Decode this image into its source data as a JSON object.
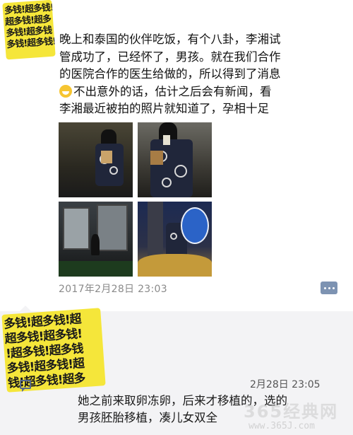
{
  "post": {
    "avatar_lines": [
      "多钱!超多钱!超",
      "超多钱!超多",
      "多钱!超多钱"
    ],
    "text_lines": [
      "晚上和泰国的伙伴吃饭，有个八卦，李湘试",
      "管成功了，已经怀了，男孩。就在我们合作",
      "的医院合作的医生给做的，所以得到了消息",
      "不出意外的话，估计之后会有新闻，看",
      "李湘最近被拍的照片就知道了，孕相十足"
    ],
    "emoji_icon": "grin-emoji-icon",
    "photos": [
      "photo-1",
      "photo-2",
      "photo-3",
      "photo-4"
    ],
    "timestamp": "2017年2月28日 23:03",
    "more_icon": "more-dots-icon"
  },
  "comment": {
    "avatar_lines": [
      "多钱!超多钱!超",
      "超多钱!超多钱!",
      "!超多钱!超多钱",
      "多钱!超多钱!超",
      "钱!超多钱!超多"
    ],
    "timestamp": "2月28日 23:05",
    "text_lines": [
      "她之前来取卵冻卵，后来才移植的，选的",
      "男孩胚胎移植，凑儿女双全"
    ],
    "comment_icon": "comment-icon"
  },
  "watermark": {
    "text": "365经典网",
    "url": "www.365J.com"
  },
  "colors": {
    "link": "#586a8c",
    "comment_bg": "#f3f3f5",
    "avatar_bg": "#f5e63a",
    "timestamp": "#8a8a8a"
  }
}
